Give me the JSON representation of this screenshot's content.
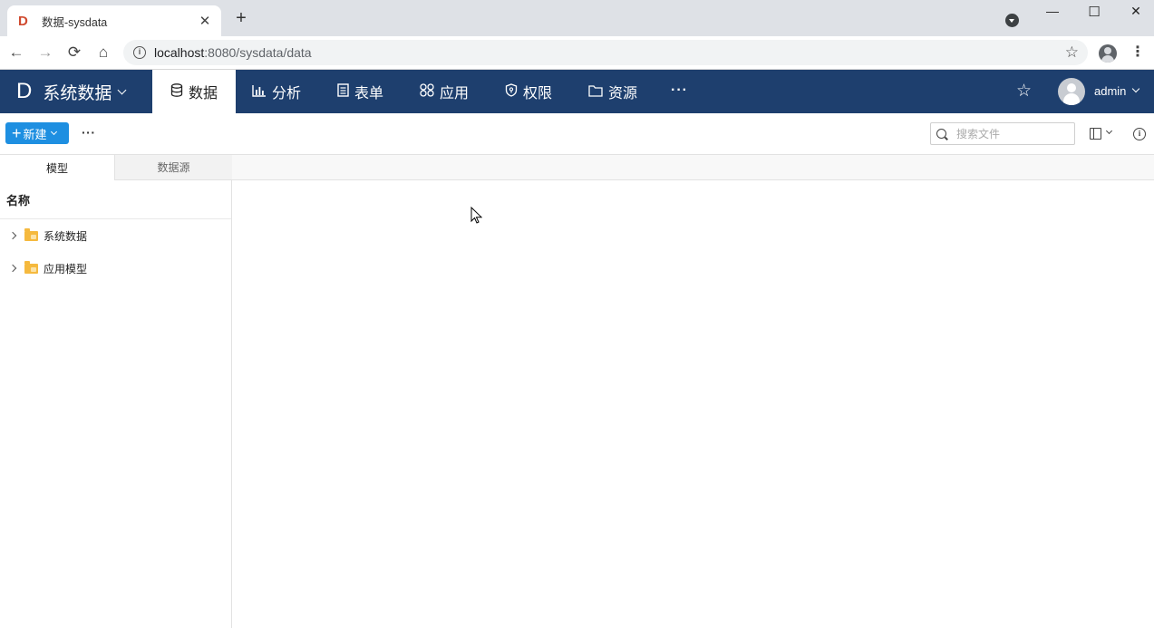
{
  "browser": {
    "tab_title": "数据-sysdata",
    "tab_favicon": "D",
    "url_host": "localhost",
    "url_path": ":8080/sysdata/data"
  },
  "icons": {
    "back": "←",
    "forward": "→",
    "reload": "⟳",
    "home": "⌂",
    "star": "☆",
    "close": "✕",
    "new_tab": "+",
    "minimize": "—",
    "maximize": "☐",
    "window_close": "✕",
    "kebab": "⋮"
  },
  "app": {
    "logo": "D",
    "title": "系统数据",
    "nav": [
      {
        "label": "数据",
        "icon": "database-icon",
        "active": true
      },
      {
        "label": "分析",
        "icon": "bar-chart-icon",
        "active": false
      },
      {
        "label": "表单",
        "icon": "form-icon",
        "active": false
      },
      {
        "label": "应用",
        "icon": "apps-icon",
        "active": false
      },
      {
        "label": "权限",
        "icon": "shield-icon",
        "active": false
      },
      {
        "label": "资源",
        "icon": "folder-icon",
        "active": false
      }
    ],
    "more": "···",
    "username": "admin",
    "header_color": "#1e3f6e",
    "accent_color": "#1e8fe1"
  },
  "actionbar": {
    "new_label": "新建",
    "more": "···",
    "search_placeholder": "搜索文件"
  },
  "panel": {
    "tabs": [
      "模型",
      "数据源"
    ],
    "column_header": "名称",
    "items": [
      {
        "label": "系统数据",
        "icon": "folder-data-icon"
      },
      {
        "label": "应用模型",
        "icon": "folder-apps-icon"
      }
    ]
  }
}
